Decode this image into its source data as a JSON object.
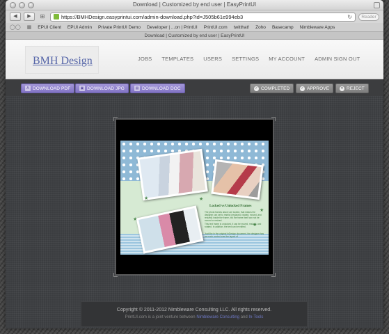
{
  "browser": {
    "window_title": "Download | Customized by end user | EasyPrintUI",
    "url": "https://BMHDesign.easyprintui.com/admin-download.php?id=J505b61e994eb3",
    "reader_label": "Reader",
    "tab_title": "Download | Customized by end user | EasyPrintUI",
    "bookmarks": [
      "EPUI Client",
      "EPUI Admin",
      "Private PrintUI Demo",
      "Developer | ...on | PrintUI",
      "PrintUI.com",
      "twitthat!",
      "Zoho",
      "Basecamp",
      "Nimbleware Apps"
    ]
  },
  "header": {
    "logo_text": "BMH Design",
    "nav": [
      "JOBS",
      "TEMPLATES",
      "USERS",
      "SETTINGS",
      "MY ACCOUNT",
      "ADMIN SIGN OUT"
    ]
  },
  "actions": {
    "download_pdf": "DOWNLOAD PDF",
    "download_jpg": "DOWNLOAD JPG",
    "download_doc": "DOWNLOAD DOC",
    "completed": "COMPLETED",
    "approve": "APPROVE",
    "reject": "REJECT"
  },
  "document": {
    "heading": "Locked vs Unlocked Frames",
    "paragraph1": "The photo frames above are locked, that means the designer can set to restrict (replaced, rotated, moved, and resized) inside the frame, but the frame itself can not be moved or resized.",
    "paragraph2": "This text frame is unlocked, it can be moved, resized, and rotated. In addition, the text can be edited.",
    "paragraph3": "Just like in the original InDesign document, the designer has as much control over the layout of"
  },
  "footer": {
    "copyright": "Copyright © 2011-2012 Nimbleware Consulting LLC. All rights reserved.",
    "venture_prefix": "PrintUI.com is a joint venture between",
    "venture_link1": "Nimbleware Consulting",
    "venture_and": "and",
    "venture_link2": "In-Tools"
  },
  "colors": {
    "accent_purple": "#8c7fcc",
    "button_gray": "#8a8a8a",
    "logo_blue": "#5565a8"
  }
}
